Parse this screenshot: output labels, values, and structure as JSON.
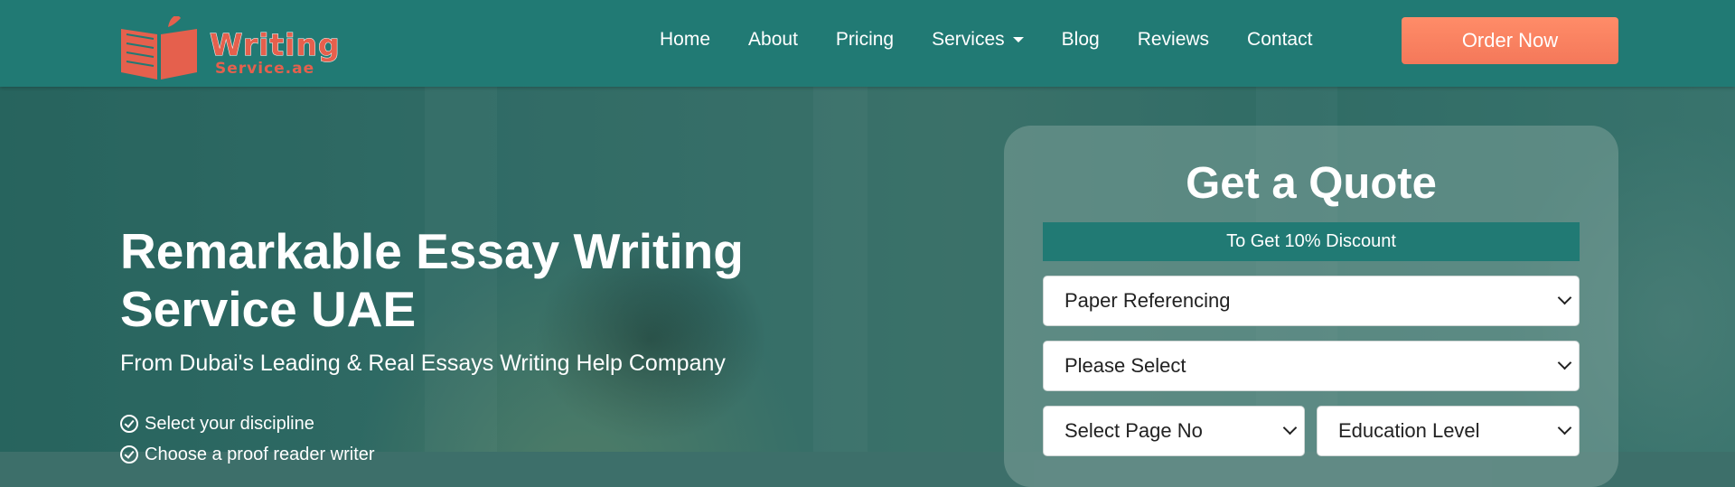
{
  "header": {
    "logo": {
      "line1": "Writing",
      "line2": "Service.ae"
    },
    "nav": [
      {
        "label": "Home"
      },
      {
        "label": "About"
      },
      {
        "label": "Pricing"
      },
      {
        "label": "Services",
        "dropdown": true
      },
      {
        "label": "Blog"
      },
      {
        "label": "Reviews"
      },
      {
        "label": "Contact"
      }
    ],
    "cta_label": "Order Now"
  },
  "hero": {
    "title": "Remarkable Essay Writing Service UAE",
    "subtitle": "From Dubai's Leading & Real Essays Writing Help Company",
    "features": [
      "Select your discipline",
      "Choose a proof reader writer"
    ]
  },
  "quote_form": {
    "title": "Get a Quote",
    "discount": "To Get 10% Discount",
    "fields": {
      "referencing": "Paper Referencing",
      "paper_type": "Please Select",
      "pages": "Select Page No",
      "education": "Education Level"
    }
  },
  "colors": {
    "header_bg": "#217a74",
    "accent": "#f4785a",
    "logo": "#e5604d"
  }
}
